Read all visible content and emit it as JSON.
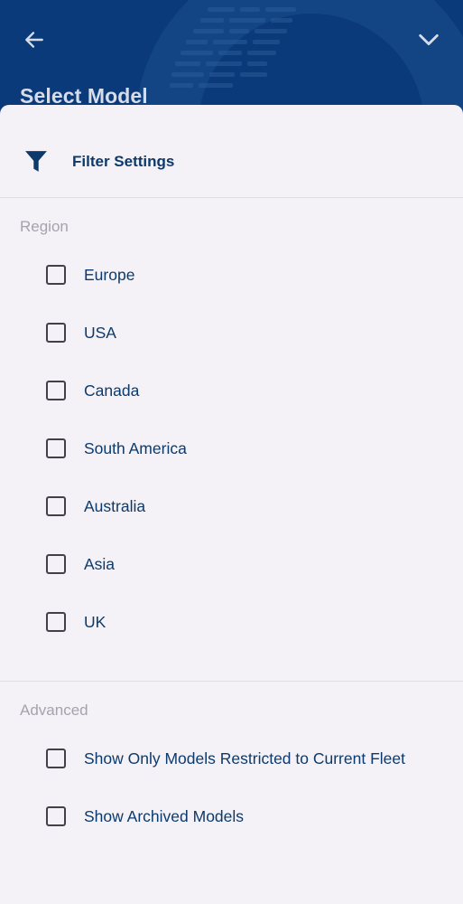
{
  "header": {
    "title": "Select Model",
    "back_icon": "arrow-left-icon",
    "collapse_icon": "chevron-down-icon",
    "background_color": "#0b3a7a"
  },
  "sheet": {
    "title": "Filter Settings",
    "icon": "filter-icon",
    "accent_color": "#0d3a6b",
    "background_color": "#f4f1f7"
  },
  "region": {
    "label": "Region",
    "options": [
      {
        "label": "Europe",
        "checked": false
      },
      {
        "label": "USA",
        "checked": false
      },
      {
        "label": "Canada",
        "checked": false
      },
      {
        "label": "South America",
        "checked": false
      },
      {
        "label": "Australia",
        "checked": false
      },
      {
        "label": "Asia",
        "checked": false
      },
      {
        "label": "UK",
        "checked": false
      }
    ]
  },
  "advanced": {
    "label": "Advanced",
    "options": [
      {
        "label": "Show Only Models Restricted to Current Fleet",
        "checked": false
      },
      {
        "label": "Show Archived Models",
        "checked": false
      }
    ]
  }
}
